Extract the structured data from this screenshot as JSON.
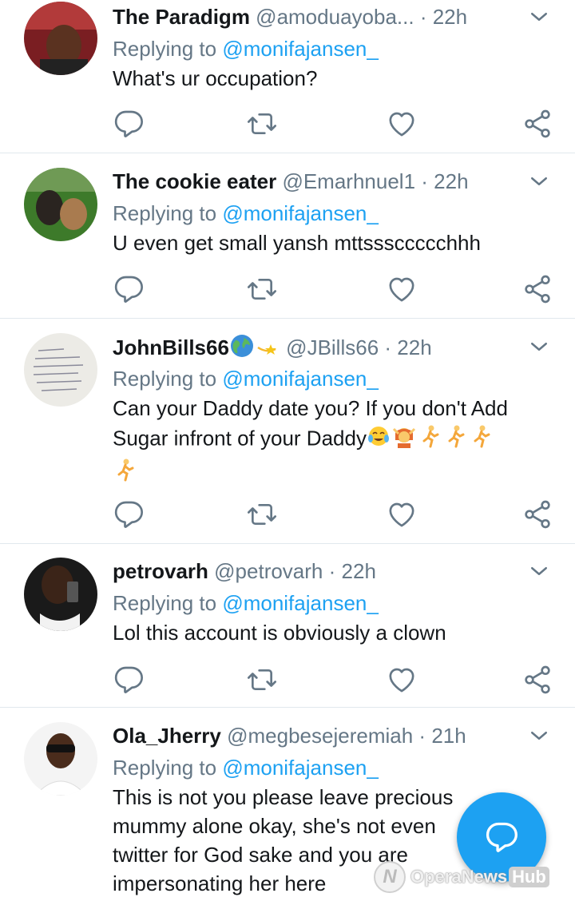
{
  "tweets": [
    {
      "name": "The Paradigm",
      "handle": "@amoduayoba...",
      "time": "22h",
      "replying_prefix": "Replying to ",
      "replying_to": "@monifajansen_",
      "text": "What's ur occupation?"
    },
    {
      "name": "The cookie eater",
      "handle": "@Emarhnuel1",
      "time": "22h",
      "replying_prefix": "Replying to ",
      "replying_to": "@monifajansen_",
      "text": "U even get small yansh mttsssccccchhh"
    },
    {
      "name": "JohnBills66",
      "handle": "@JBills66",
      "time": "22h",
      "replying_prefix": "Replying to ",
      "replying_to": "@monifajansen_",
      "text_line1": "Can your Daddy date you? If you don't Add",
      "text_line2": "Sugar infront of your Daddy"
    },
    {
      "name": "petrovarh",
      "handle": "@petrovarh",
      "time": "22h",
      "replying_prefix": "Replying to ",
      "replying_to": "@monifajansen_",
      "text": "Lol this account is obviously a clown"
    },
    {
      "name": "Ola_Jherry",
      "handle": "@megbesejeremiah",
      "time": "21h",
      "replying_prefix": "Replying to ",
      "replying_to": "@monifajansen_",
      "text_line1": "This is not you please leave precious",
      "text_line2": "mummy alone okay, she's not even",
      "text_line3": "twitter for God sake and you are",
      "text_line4": "impersonating her here"
    }
  ],
  "separator": "·",
  "watermark": {
    "brand": "OperaNews",
    "hub": "Hub"
  },
  "colors": {
    "accent": "#1da1f2",
    "muted": "#657786",
    "text": "#14171a",
    "divider": "#e1e8ed"
  }
}
